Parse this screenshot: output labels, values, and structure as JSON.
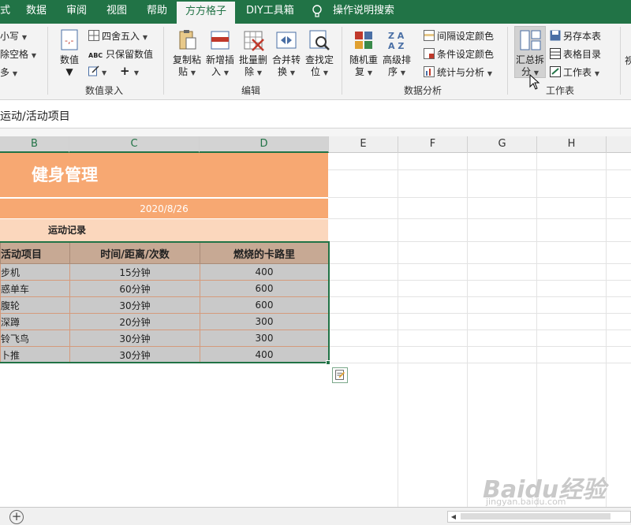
{
  "tabs": {
    "partial": "式",
    "data": "数据",
    "review": "审阅",
    "view": "视图",
    "help": "帮助",
    "fangfang": "方方格子",
    "diy": "DIY工具箱",
    "search": "操作说明搜索"
  },
  "ribbon": {
    "left_partial": {
      "item1": "小写",
      "item2": "除空格",
      "item3": "多"
    },
    "numeric_entry": {
      "value_label": "数值",
      "round_label": "四舍五入",
      "abc_tag": "ABC",
      "keep_value_label": "只保留数值",
      "plus_label": "+",
      "group_label": "数值录入"
    },
    "edit": {
      "copy_paste_1": "复制粘",
      "copy_paste_2": "贴",
      "insert_1": "新增插",
      "insert_2": "入",
      "batch_delete_1": "批量删",
      "batch_delete_2": "除",
      "merge_1": "合并转",
      "merge_2": "换",
      "locate_1": "查找定",
      "locate_2": "位",
      "group_label": "编辑"
    },
    "analysis": {
      "random_1": "随机重",
      "random_2": "复",
      "sort_1": "高级排",
      "sort_2": "序",
      "interval_color": "间隔设定颜色",
      "condition_color": "条件设定颜色",
      "stats": "统计与分析",
      "group_label": "数据分析"
    },
    "worksheet": {
      "summary_1": "汇总拆",
      "summary_2": "分",
      "save_sheet": "另存本表",
      "sheet_index": "表格目录",
      "worksheet": "工作表",
      "group_label": "工作表",
      "right_partial": "视"
    }
  },
  "formula_bar": {
    "content": "运动/活动项目"
  },
  "columns": [
    "B",
    "C",
    "D",
    "E",
    "F",
    "G",
    "H"
  ],
  "sheet": {
    "title": "健身管理",
    "date": "2020/8/26",
    "record_label": "运动记录",
    "headers": [
      "活动项目",
      "时间/距离/次数",
      "燃烧的卡路里"
    ],
    "rows": [
      [
        "步机",
        "15分钟",
        "400"
      ],
      [
        "惑单车",
        "60分钟",
        "600"
      ],
      [
        "腹轮",
        "30分钟",
        "600"
      ],
      [
        "深蹲",
        "20分钟",
        "300"
      ],
      [
        "铃飞鸟",
        "30分钟",
        "300"
      ],
      [
        "卜推",
        "30分钟",
        "400"
      ]
    ]
  },
  "watermark": {
    "brand": "Baidu经验",
    "url": "jingyan.baidu.com"
  },
  "colors": {
    "accent": "#217346",
    "title_fill": "#f7a872",
    "record_fill": "#fbd7bd",
    "header_fill": "#c7a994",
    "data_fill": "#c9c9c9"
  }
}
